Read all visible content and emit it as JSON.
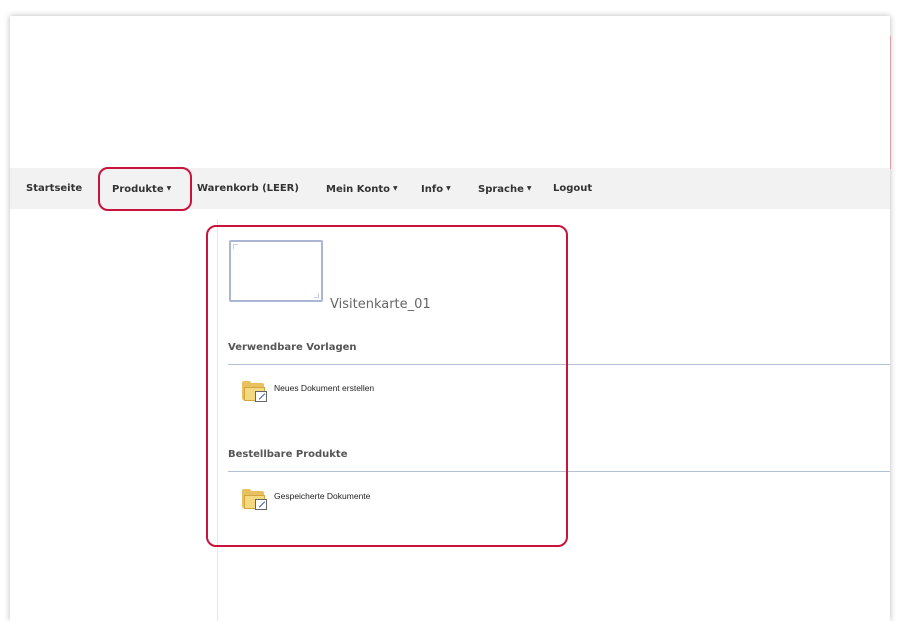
{
  "nav": {
    "items": [
      {
        "label": "Startseite",
        "caret": ""
      },
      {
        "label": "Produkte",
        "caret": "▼"
      },
      {
        "label": "Warenkorb (LEER)",
        "caret": ""
      },
      {
        "label": "Mein Konto",
        "caret": "▼"
      },
      {
        "label": "Info",
        "caret": "▼"
      },
      {
        "label": "Sprache",
        "caret": "▼"
      },
      {
        "label": "Logout",
        "caret": ""
      }
    ]
  },
  "product": {
    "title": "Visitenkarte_01"
  },
  "sections": [
    {
      "heading": "Verwendbare Vorlagen",
      "link_label": "Neues Dokument erstellen",
      "link_icon": "folder-edit-icon"
    },
    {
      "heading": "Bestellbare Produkte",
      "link_label": "Gespeicherte Dokumente",
      "link_icon": "folder-edit-icon"
    }
  ],
  "colors": {
    "highlight": "#c8143c",
    "navbar_bg": "#f2f2f2",
    "section_rule": "#b4c0d6"
  }
}
